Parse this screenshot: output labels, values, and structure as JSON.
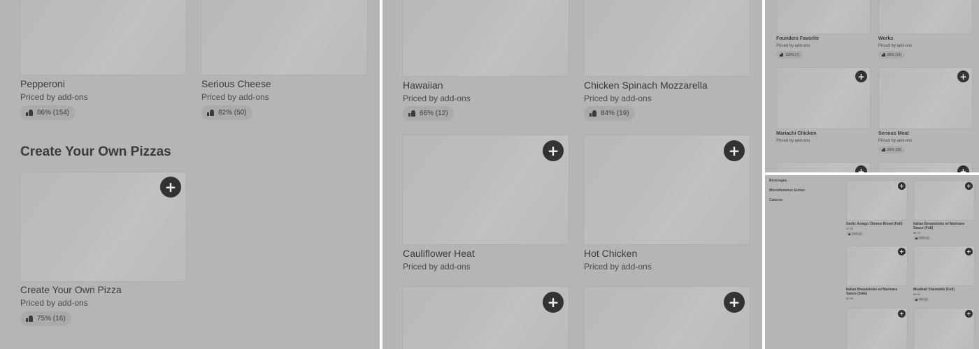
{
  "panel1": {
    "items": [
      {
        "name": "Pepperoni",
        "price": "Priced by add-ons",
        "rating": "86% (154)"
      },
      {
        "name": "Serious Cheese",
        "price": "Priced by add-ons",
        "rating": "82% (50)"
      }
    ],
    "section_title": "Create Your Own Pizzas",
    "section_item": {
      "name": "Create Your Own Pizza",
      "price": "Priced by add-ons",
      "rating": "75% (16)",
      "add_label": "+"
    }
  },
  "panel2": {
    "items": [
      {
        "name": "Hawaiian",
        "price": "Priced by add-ons",
        "rating": "66% (12)"
      },
      {
        "name": "Chicken Spinach Mozzarella",
        "price": "Priced by add-ons",
        "rating": "84% (19)"
      },
      {
        "name": "Cauliflower Heat",
        "price": "Priced by add-ons",
        "add_label": "+"
      },
      {
        "name": "Hot Chicken",
        "price": "Priced by add-ons",
        "add_label": "+"
      }
    ],
    "add_label": "+"
  },
  "panel3": {
    "items": [
      {
        "name": "Founders Favorite",
        "price": "Priced by add-ons",
        "rating": "100% (7)"
      },
      {
        "name": "Works",
        "price": "Priced by add-ons",
        "rating": "85% (14)"
      },
      {
        "name": "Mariachi Chicken",
        "price": "Priced by add-ons"
      },
      {
        "name": "Serious Meat",
        "price": "Priced by add-ons",
        "rating": "89% (28)"
      }
    ],
    "add_label": "+"
  },
  "panel4": {
    "categories": [
      "Beverages",
      "Miscellaneous Extras",
      "Calzone"
    ],
    "items": [
      {
        "name": "Garlic Asiago Cheese Bread (Full)",
        "price": "$7.50",
        "rating": "100% (4)"
      },
      {
        "name": "Italian Breadsticks w/ Marinara Sauce (Full)",
        "price": "$6.75",
        "rating": "100% (5)"
      },
      {
        "name": "Italian Breadsticks w/ Marinara Sauce (Side)",
        "price": "$3.50"
      },
      {
        "name": "Meatball Shareable (Full)",
        "price": "$8.00",
        "rating": "98% (3)"
      }
    ],
    "add_label": "+"
  },
  "icons": {
    "add": "plus-icon",
    "like": "thumbs-up-icon"
  },
  "colors": {
    "overlay": "#b5b5b5",
    "button": "#333333",
    "pill": "#aaaaaa"
  }
}
